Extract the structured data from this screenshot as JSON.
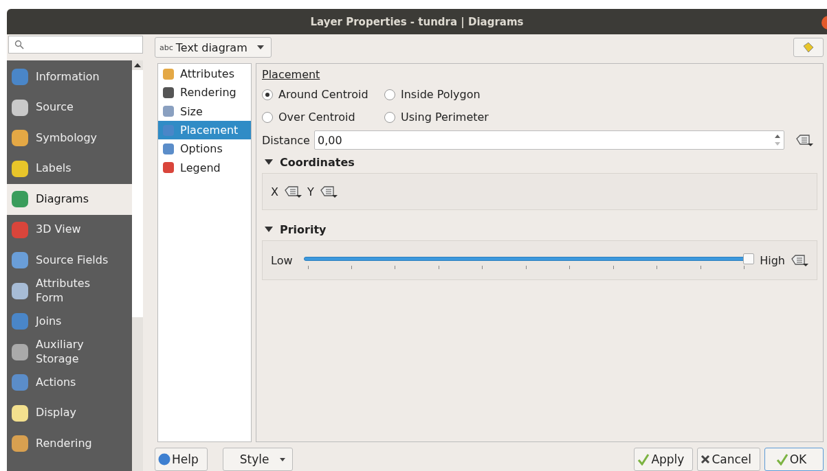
{
  "window": {
    "title": "Layer Properties - tundra | Diagrams"
  },
  "sidebar": {
    "items": [
      {
        "label": "Information",
        "selected": false
      },
      {
        "label": "Source",
        "selected": false
      },
      {
        "label": "Symbology",
        "selected": false
      },
      {
        "label": "Labels",
        "selected": false
      },
      {
        "label": "Diagrams",
        "selected": true
      },
      {
        "label": "3D View",
        "selected": false
      },
      {
        "label": "Source Fields",
        "selected": false
      },
      {
        "label": "Attributes Form",
        "selected": false
      },
      {
        "label": "Joins",
        "selected": false
      },
      {
        "label": "Auxiliary Storage",
        "selected": false
      },
      {
        "label": "Actions",
        "selected": false
      },
      {
        "label": "Display",
        "selected": false
      },
      {
        "label": "Rendering",
        "selected": false
      }
    ]
  },
  "diagram_type": {
    "prefix": "abc",
    "value": "Text diagram"
  },
  "sections": {
    "items": [
      {
        "label": "Attributes",
        "selected": false
      },
      {
        "label": "Rendering",
        "selected": false
      },
      {
        "label": "Size",
        "selected": false
      },
      {
        "label": "Placement",
        "selected": true
      },
      {
        "label": "Options",
        "selected": false
      },
      {
        "label": "Legend",
        "selected": false
      }
    ]
  },
  "placement": {
    "heading": "Placement",
    "options": [
      {
        "label": "Around Centroid",
        "selected": true
      },
      {
        "label": "Inside Polygon",
        "selected": false
      },
      {
        "label": "Over Centroid",
        "selected": false
      },
      {
        "label": "Using Perimeter",
        "selected": false
      }
    ],
    "distance": {
      "label": "Distance",
      "value": "0,00"
    },
    "coordinates": {
      "title": "Coordinates",
      "expanded": true,
      "x_label": "X",
      "y_label": "Y"
    },
    "priority": {
      "title": "Priority",
      "expanded": true,
      "low": "Low",
      "high": "High",
      "level": 1
    }
  },
  "buttons": {
    "help": "Help",
    "style": "Style",
    "apply": "Apply",
    "cancel": "Cancel",
    "ok": "OK"
  }
}
